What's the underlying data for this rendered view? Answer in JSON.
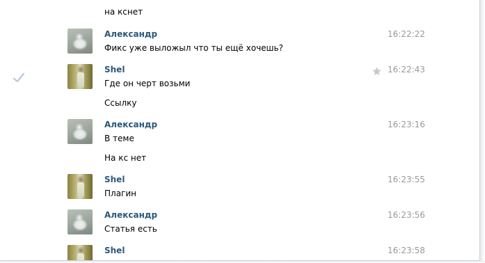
{
  "messages": [
    {
      "author": "",
      "time": "",
      "lines": [
        "на кснет"
      ]
    },
    {
      "author": "Александр",
      "time": "16:22:22",
      "lines": [
        "Фикс уже выложыл что ты ещё хочешь?"
      ]
    },
    {
      "author": "Shel",
      "time": "16:22:43",
      "lines": [
        "Где он черт возьми",
        "Ссылку"
      ],
      "starred": true,
      "read_check": true
    },
    {
      "author": "Александр",
      "time": "16:23:16",
      "lines": [
        "В теме",
        "На кс нет"
      ]
    },
    {
      "author": "Shel",
      "time": "16:23:55",
      "lines": [
        "Плагин"
      ]
    },
    {
      "author": "Александр",
      "time": "16:23:56",
      "lines": [
        "Статья есть"
      ]
    },
    {
      "author": "Shel",
      "time": "16:23:58",
      "lines": []
    }
  ],
  "colors": {
    "author": "#2b587a",
    "time": "#999999",
    "border": "#c5d0db",
    "check": "#b6c9dc",
    "star": "#c8c8c8"
  },
  "icons": {
    "check": "check-icon",
    "star": "star-icon"
  }
}
